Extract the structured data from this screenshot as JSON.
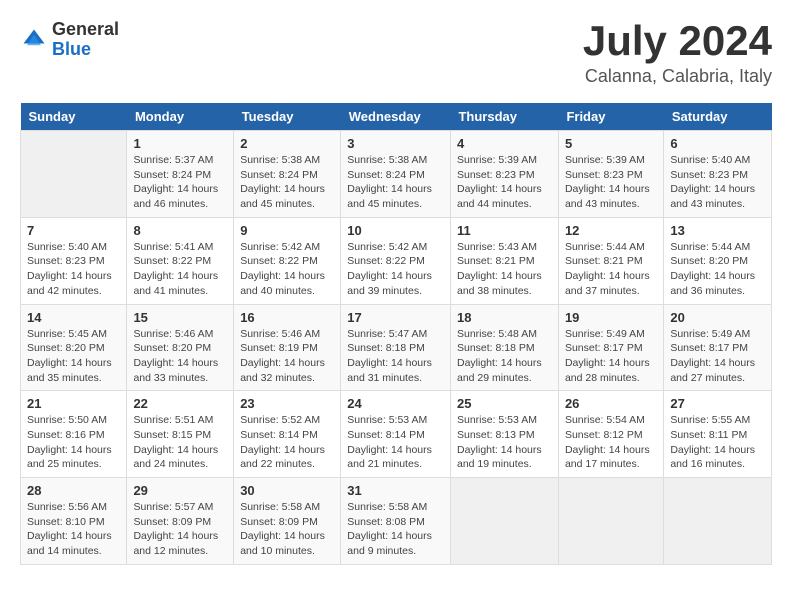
{
  "header": {
    "logo_general": "General",
    "logo_blue": "Blue",
    "title": "July 2024",
    "subtitle": "Calanna, Calabria, Italy"
  },
  "weekdays": [
    "Sunday",
    "Monday",
    "Tuesday",
    "Wednesday",
    "Thursday",
    "Friday",
    "Saturday"
  ],
  "weeks": [
    [
      {
        "day": "",
        "info": ""
      },
      {
        "day": "1",
        "info": "Sunrise: 5:37 AM\nSunset: 8:24 PM\nDaylight: 14 hours\nand 46 minutes."
      },
      {
        "day": "2",
        "info": "Sunrise: 5:38 AM\nSunset: 8:24 PM\nDaylight: 14 hours\nand 45 minutes."
      },
      {
        "day": "3",
        "info": "Sunrise: 5:38 AM\nSunset: 8:24 PM\nDaylight: 14 hours\nand 45 minutes."
      },
      {
        "day": "4",
        "info": "Sunrise: 5:39 AM\nSunset: 8:23 PM\nDaylight: 14 hours\nand 44 minutes."
      },
      {
        "day": "5",
        "info": "Sunrise: 5:39 AM\nSunset: 8:23 PM\nDaylight: 14 hours\nand 43 minutes."
      },
      {
        "day": "6",
        "info": "Sunrise: 5:40 AM\nSunset: 8:23 PM\nDaylight: 14 hours\nand 43 minutes."
      }
    ],
    [
      {
        "day": "7",
        "info": "Sunrise: 5:40 AM\nSunset: 8:23 PM\nDaylight: 14 hours\nand 42 minutes."
      },
      {
        "day": "8",
        "info": "Sunrise: 5:41 AM\nSunset: 8:22 PM\nDaylight: 14 hours\nand 41 minutes."
      },
      {
        "day": "9",
        "info": "Sunrise: 5:42 AM\nSunset: 8:22 PM\nDaylight: 14 hours\nand 40 minutes."
      },
      {
        "day": "10",
        "info": "Sunrise: 5:42 AM\nSunset: 8:22 PM\nDaylight: 14 hours\nand 39 minutes."
      },
      {
        "day": "11",
        "info": "Sunrise: 5:43 AM\nSunset: 8:21 PM\nDaylight: 14 hours\nand 38 minutes."
      },
      {
        "day": "12",
        "info": "Sunrise: 5:44 AM\nSunset: 8:21 PM\nDaylight: 14 hours\nand 37 minutes."
      },
      {
        "day": "13",
        "info": "Sunrise: 5:44 AM\nSunset: 8:20 PM\nDaylight: 14 hours\nand 36 minutes."
      }
    ],
    [
      {
        "day": "14",
        "info": "Sunrise: 5:45 AM\nSunset: 8:20 PM\nDaylight: 14 hours\nand 35 minutes."
      },
      {
        "day": "15",
        "info": "Sunrise: 5:46 AM\nSunset: 8:20 PM\nDaylight: 14 hours\nand 33 minutes."
      },
      {
        "day": "16",
        "info": "Sunrise: 5:46 AM\nSunset: 8:19 PM\nDaylight: 14 hours\nand 32 minutes."
      },
      {
        "day": "17",
        "info": "Sunrise: 5:47 AM\nSunset: 8:18 PM\nDaylight: 14 hours\nand 31 minutes."
      },
      {
        "day": "18",
        "info": "Sunrise: 5:48 AM\nSunset: 8:18 PM\nDaylight: 14 hours\nand 29 minutes."
      },
      {
        "day": "19",
        "info": "Sunrise: 5:49 AM\nSunset: 8:17 PM\nDaylight: 14 hours\nand 28 minutes."
      },
      {
        "day": "20",
        "info": "Sunrise: 5:49 AM\nSunset: 8:17 PM\nDaylight: 14 hours\nand 27 minutes."
      }
    ],
    [
      {
        "day": "21",
        "info": "Sunrise: 5:50 AM\nSunset: 8:16 PM\nDaylight: 14 hours\nand 25 minutes."
      },
      {
        "day": "22",
        "info": "Sunrise: 5:51 AM\nSunset: 8:15 PM\nDaylight: 14 hours\nand 24 minutes."
      },
      {
        "day": "23",
        "info": "Sunrise: 5:52 AM\nSunset: 8:14 PM\nDaylight: 14 hours\nand 22 minutes."
      },
      {
        "day": "24",
        "info": "Sunrise: 5:53 AM\nSunset: 8:14 PM\nDaylight: 14 hours\nand 21 minutes."
      },
      {
        "day": "25",
        "info": "Sunrise: 5:53 AM\nSunset: 8:13 PM\nDaylight: 14 hours\nand 19 minutes."
      },
      {
        "day": "26",
        "info": "Sunrise: 5:54 AM\nSunset: 8:12 PM\nDaylight: 14 hours\nand 17 minutes."
      },
      {
        "day": "27",
        "info": "Sunrise: 5:55 AM\nSunset: 8:11 PM\nDaylight: 14 hours\nand 16 minutes."
      }
    ],
    [
      {
        "day": "28",
        "info": "Sunrise: 5:56 AM\nSunset: 8:10 PM\nDaylight: 14 hours\nand 14 minutes."
      },
      {
        "day": "29",
        "info": "Sunrise: 5:57 AM\nSunset: 8:09 PM\nDaylight: 14 hours\nand 12 minutes."
      },
      {
        "day": "30",
        "info": "Sunrise: 5:58 AM\nSunset: 8:09 PM\nDaylight: 14 hours\nand 10 minutes."
      },
      {
        "day": "31",
        "info": "Sunrise: 5:58 AM\nSunset: 8:08 PM\nDaylight: 14 hours\nand 9 minutes."
      },
      {
        "day": "",
        "info": ""
      },
      {
        "day": "",
        "info": ""
      },
      {
        "day": "",
        "info": ""
      }
    ]
  ]
}
